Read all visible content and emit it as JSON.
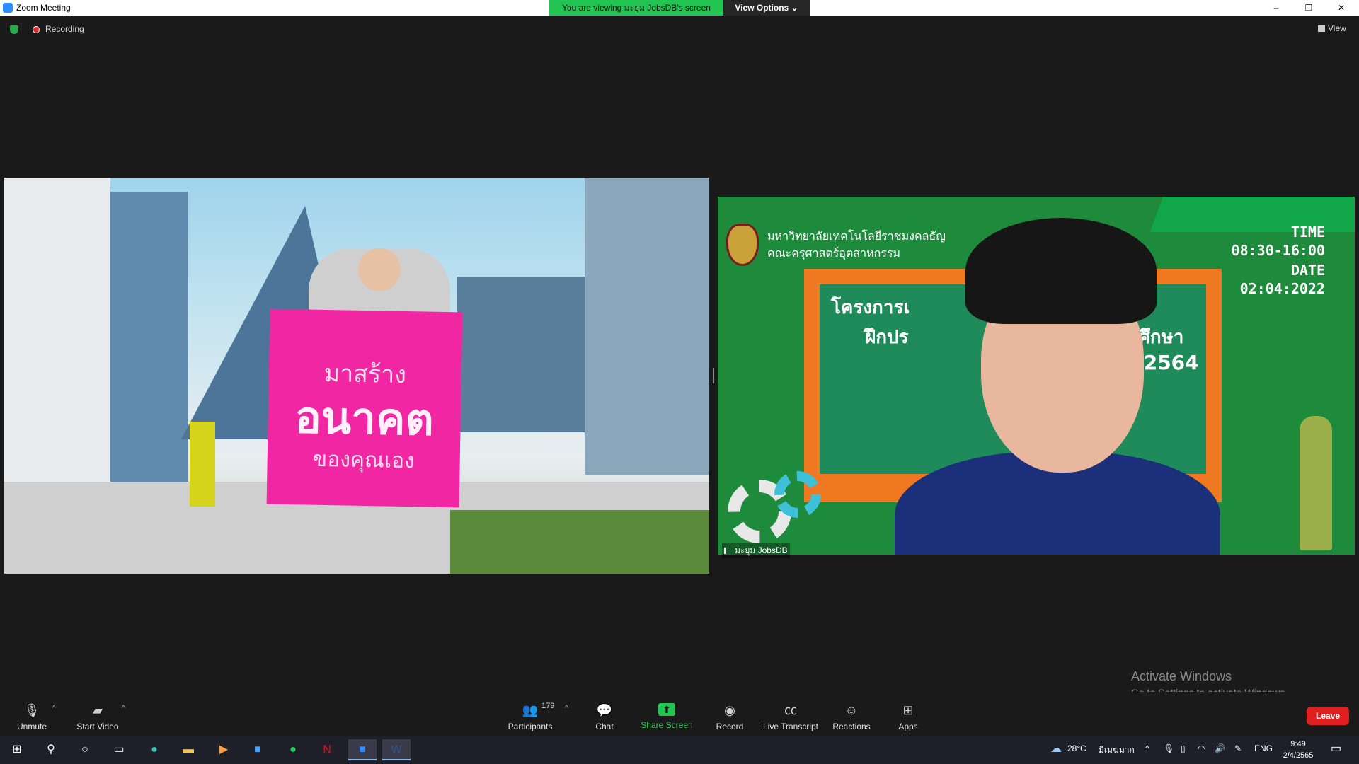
{
  "window": {
    "title": "Zoom Meeting",
    "minimize": "–",
    "restore": "❐",
    "close": "✕"
  },
  "share_banner": {
    "text": "You are viewing มะยุม JobsDB's screen",
    "view_options": "View Options ⌄"
  },
  "status": {
    "recording": "Recording",
    "view": "View"
  },
  "video_left": {
    "sign_line1": "มาสร้าง",
    "sign_line2": "อนาคต",
    "sign_line3": "ของคุณเอง"
  },
  "video_right": {
    "university_line1": "มหาวิทยาลัยเทคโนโลยีราชมงคลธัญ",
    "university_line2": "คณะครุศาสตร์อุตสาหกรรม",
    "board_line1": "โครงการเ",
    "board_line2": "ฝึกปร",
    "board_line3": "านศึกษา",
    "board_line4": "2/2564",
    "time_label": "TIME",
    "time_value": "08:30-16:00",
    "date_label": "DATE",
    "date_value": "02:04:2022",
    "participant_name": "มะยุม JobsDB"
  },
  "activation": {
    "title": "Activate Windows",
    "subtitle": "Go to Settings to activate Windows."
  },
  "toolbar": {
    "unmute": "Unmute",
    "start_video": "Start Video",
    "participants": "Participants",
    "participant_count": "179",
    "chat": "Chat",
    "share_screen": "Share Screen",
    "record": "Record",
    "live_transcript": "Live Transcript",
    "reactions": "Reactions",
    "apps": "Apps",
    "leave": "Leave",
    "caret": "^"
  },
  "taskbar": {
    "weather": "28°C",
    "weather_text": "มีเมฆมาก",
    "language": "ENG",
    "time": "9:49",
    "date": "2/4/2565"
  }
}
